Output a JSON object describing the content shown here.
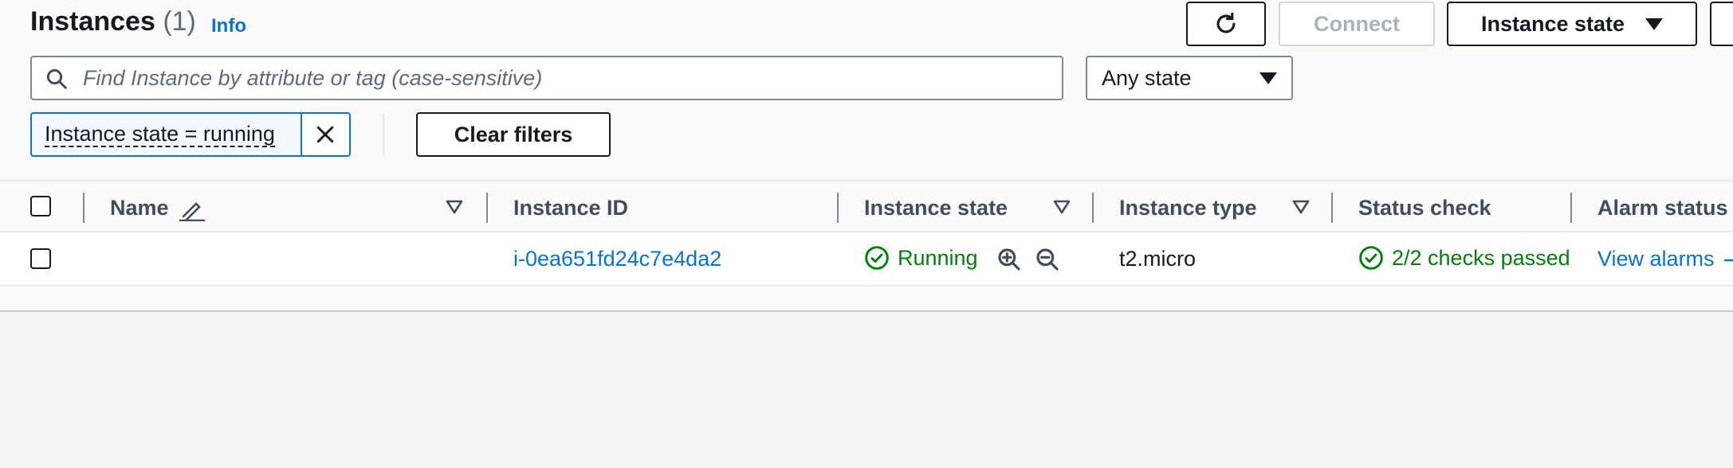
{
  "header": {
    "title": "Instances",
    "count": "(1)",
    "info_label": "Info",
    "connect_label": "Connect",
    "instance_state_label": "Instance state"
  },
  "search": {
    "placeholder": "Find Instance by attribute or tag (case-sensitive)"
  },
  "state_filter": {
    "selected": "Any state"
  },
  "filters": {
    "active_token": "Instance state = running",
    "clear_label": "Clear filters"
  },
  "table": {
    "columns": [
      "Name",
      "Instance ID",
      "Instance state",
      "Instance type",
      "Status check",
      "Alarm status"
    ],
    "rows": [
      {
        "name": "",
        "instance_id": "i-0ea651fd24c7e4da2",
        "instance_state": "Running",
        "instance_type": "t2.micro",
        "status_check": "2/2 checks passed",
        "alarm_status": "View alarms"
      }
    ]
  },
  "colors": {
    "link": "#0972d3",
    "success": "#037f0c",
    "border": "#7d8998",
    "text": "#16191f"
  },
  "icons": [
    "refresh-icon",
    "search-icon",
    "caret-down-icon",
    "close-icon",
    "edit-icon",
    "sort-icon",
    "check-circle-icon",
    "zoom-in-icon",
    "zoom-out-icon",
    "plus-icon"
  ]
}
